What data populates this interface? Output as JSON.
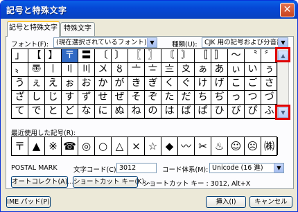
{
  "window": {
    "title": "記号と特殊文字",
    "close_glyph": "✕"
  },
  "tabs": [
    "記号と特殊文字",
    "特殊文字"
  ],
  "font": {
    "label": "フォント(F):",
    "value": "(現在選択されているフォント)"
  },
  "subset": {
    "label": "種類(U):",
    "value": "CJK 用の記号および分音記号"
  },
  "grid_rows": [
    [
      "」",
      "【",
      "】",
      "〒",
      "〓",
      "〔",
      "〕",
      "〖",
      "〗",
      "〘",
      "〙",
      "〚",
      "〛",
      "〜",
      "〝",
      "〞"
    ],
    [
      "〟",
      "〠",
      "〡",
      "〢",
      "〣",
      "〤",
      "〥",
      "〦",
      "〧",
      "〨",
      "〩",
      "ぁ",
      "あ",
      "ぃ",
      "い",
      "ぅ"
    ],
    [
      "う",
      "ぇ",
      "え",
      "ぉ",
      "お",
      "か",
      "が",
      "き",
      "ぎ",
      "く",
      "ぐ",
      "け",
      "げ",
      "こ",
      "ご",
      "さ"
    ],
    [
      "ざ",
      "し",
      "じ",
      "す",
      "ず",
      "せ",
      "ぜ",
      "そ",
      "ぞ",
      "た",
      "だ",
      "ち",
      "ぢ",
      "っ",
      "つ",
      "づ"
    ],
    [
      "て",
      "で",
      "と",
      "ど",
      "な",
      "に",
      "ぬ",
      "ね",
      "の",
      "は",
      "ば",
      "ぱ",
      "ひ",
      "び",
      "ぴ",
      "ふ"
    ]
  ],
  "recent": {
    "label": "最近使用した記号(R):",
    "symbols": [
      "〒",
      "▲",
      "※",
      "☎",
      "◎",
      "○",
      "△",
      "×",
      "☆",
      "◆",
      "〰",
      "✂",
      "♨",
      "☺",
      "☹",
      "㈱"
    ]
  },
  "char_name": "POSTAL MARK",
  "char_code": {
    "label": "文字コード(C):",
    "value": "3012"
  },
  "from": {
    "label": "コード体系(M):",
    "value": "Unicode (16 進)"
  },
  "buttons": {
    "autocorrect": "オートコレクト(A)...",
    "shortcut_key": "ショートカット キー(K)...",
    "ime_pad": "IME パッド(P)",
    "insert": "挿入(I)",
    "cancel": "キャンセル"
  },
  "shortcut_info": "ショートカット キー : 3012, Alt+X"
}
